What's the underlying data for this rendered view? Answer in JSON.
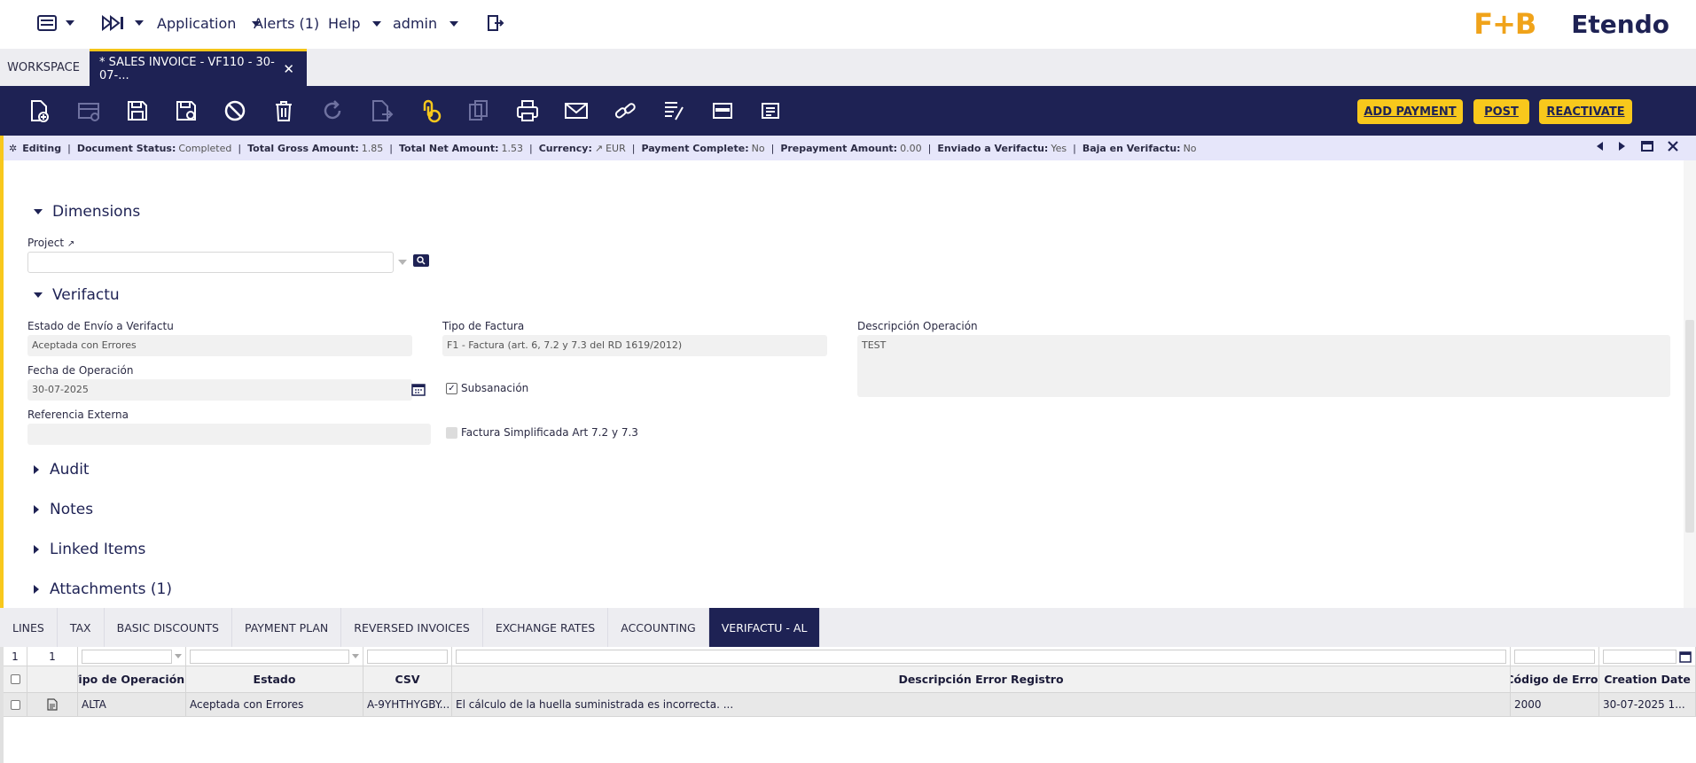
{
  "topbar": {
    "menu_icon": "list-icon",
    "forward_icon": "skip-forward-icon",
    "application": "Application",
    "alerts": "Alerts (1)",
    "help": "Help",
    "user": "admin",
    "logout_icon": "logout-icon",
    "brand_fb": "F+B",
    "brand_etendo": "Etendo"
  },
  "tabs": {
    "workspace": "WORKSPACE",
    "active": "* SALES INVOICE - VF110 - 30-07-...",
    "close": "✕"
  },
  "toolbar": {
    "icons": [
      "new-document-icon",
      "new-row-icon",
      "save-icon",
      "save-close-icon",
      "cancel-icon",
      "delete-icon",
      "refresh-icon",
      "export-icon",
      "attachment-icon",
      "copy-icon",
      "print-icon",
      "email-icon",
      "link-icon",
      "audit-icon",
      "grid-toggle-icon",
      "process-icon"
    ],
    "add_payment": "ADD PAYMENT",
    "post": "POST",
    "reactivate": "REACTIVATE"
  },
  "status": {
    "mode": "Editing",
    "doc_status_label": "Document Status:",
    "doc_status": "Completed",
    "gross_label": "Total Gross Amount:",
    "gross": "1.85",
    "net_label": "Total Net Amount:",
    "net": "1.53",
    "currency_label": "Currency:",
    "currency": "EUR",
    "payment_label": "Payment Complete:",
    "payment": "No",
    "prepayment_label": "Prepayment Amount:",
    "prepayment": "0.00",
    "enviado_label": "Enviado a Verifactu:",
    "enviado": "Yes",
    "baja_label": "Baja en Verifactu:",
    "baja": "No"
  },
  "form": {
    "dimensions": "Dimensions",
    "project_label": "Project",
    "project_value": "",
    "verifactu": "Verifactu",
    "estado_label": "Estado de Envío a Verifactu",
    "estado_value": "Aceptada con Errores",
    "tipo_label": "Tipo de Factura",
    "tipo_value": "F1 - Factura (art. 6, 7.2 y 7.3 del RD 1619/2012)",
    "desc_label": "Descripción Operación",
    "desc_value": "TEST",
    "fecha_label": "Fecha de Operación",
    "fecha_value": "30-07-2025",
    "subsanacion": "Subsanación",
    "ref_label": "Referencia Externa",
    "ref_value": "",
    "simplificada": "Factura Simplificada Art 7.2 y 7.3",
    "audit": "Audit",
    "notes": "Notes",
    "linked": "Linked Items",
    "attachments": "Attachments (1)"
  },
  "bottom_tabs": [
    "LINES",
    "TAX",
    "BASIC DISCOUNTS",
    "PAYMENT PLAN",
    "REVERSED INVOICES",
    "EXCHANGE RATES",
    "ACCOUNTING",
    "VERIFACTU - AL"
  ],
  "grid": {
    "page": "1",
    "count": "1",
    "headers": [
      "Tipo de Operación",
      "Estado",
      "CSV",
      "Descripción Error Registro",
      "Código de Error",
      "Creation Date"
    ],
    "row": [
      "ALTA",
      "Aceptada con Errores",
      "A-9YHTHYGBY...",
      "El cálculo de la huella suministrada es incorrecta.  ...",
      "2000",
      "30-07-2025 1..."
    ]
  },
  "colors": {
    "navy": "#1e2254",
    "accent": "#f8c81c"
  }
}
